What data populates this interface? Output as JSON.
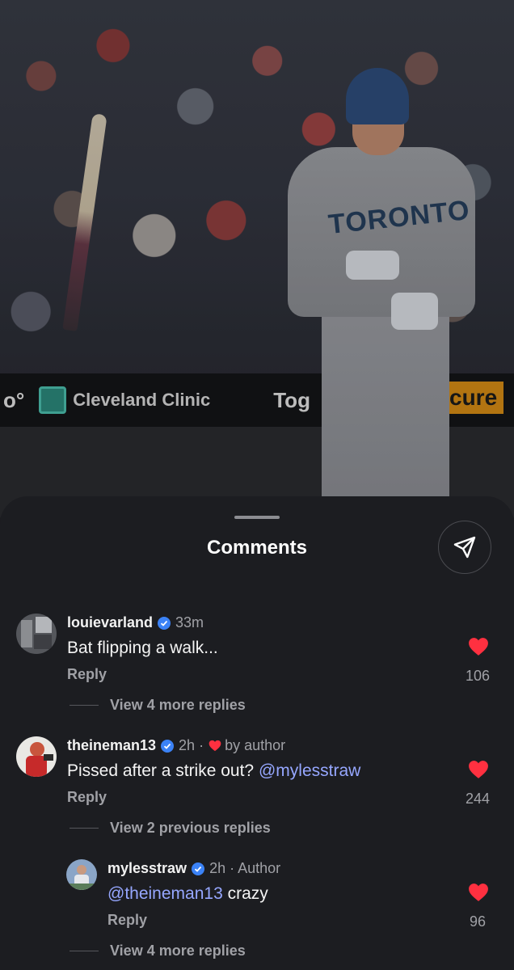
{
  "photo": {
    "board_left": "o°",
    "board_sponsor": "Cleveland Clinic",
    "board_middle": "Tog",
    "board_right": "cure",
    "jersey": "TORONTO"
  },
  "sheet": {
    "title": "Comments"
  },
  "comments": [
    {
      "username": "louievarland",
      "verified": true,
      "time": "33m",
      "text": "Bat flipping a walk...",
      "reply_label": "Reply",
      "likes": "106",
      "view_more": "View 4 more replies"
    },
    {
      "username": "theineman13",
      "verified": true,
      "time": "2h ·",
      "by_author": "by author",
      "text": "Pissed after a strike out?",
      "mention": "@mylesstraw",
      "reply_label": "Reply",
      "likes": "244",
      "view_more": "View 2 previous replies"
    },
    {
      "username": "mylesstraw",
      "verified": true,
      "time": "2h · Author",
      "mention": "@theineman13",
      "text": "crazy",
      "reply_label": "Reply",
      "likes": "96",
      "view_more": "View 4 more replies"
    }
  ],
  "colors": {
    "background": "#1c1d21",
    "heart": "#ff3040",
    "mention": "#96a7ff",
    "verified": "#3b82f6"
  },
  "icons": [
    "send-icon",
    "verified-badge-icon",
    "heart-icon"
  ]
}
